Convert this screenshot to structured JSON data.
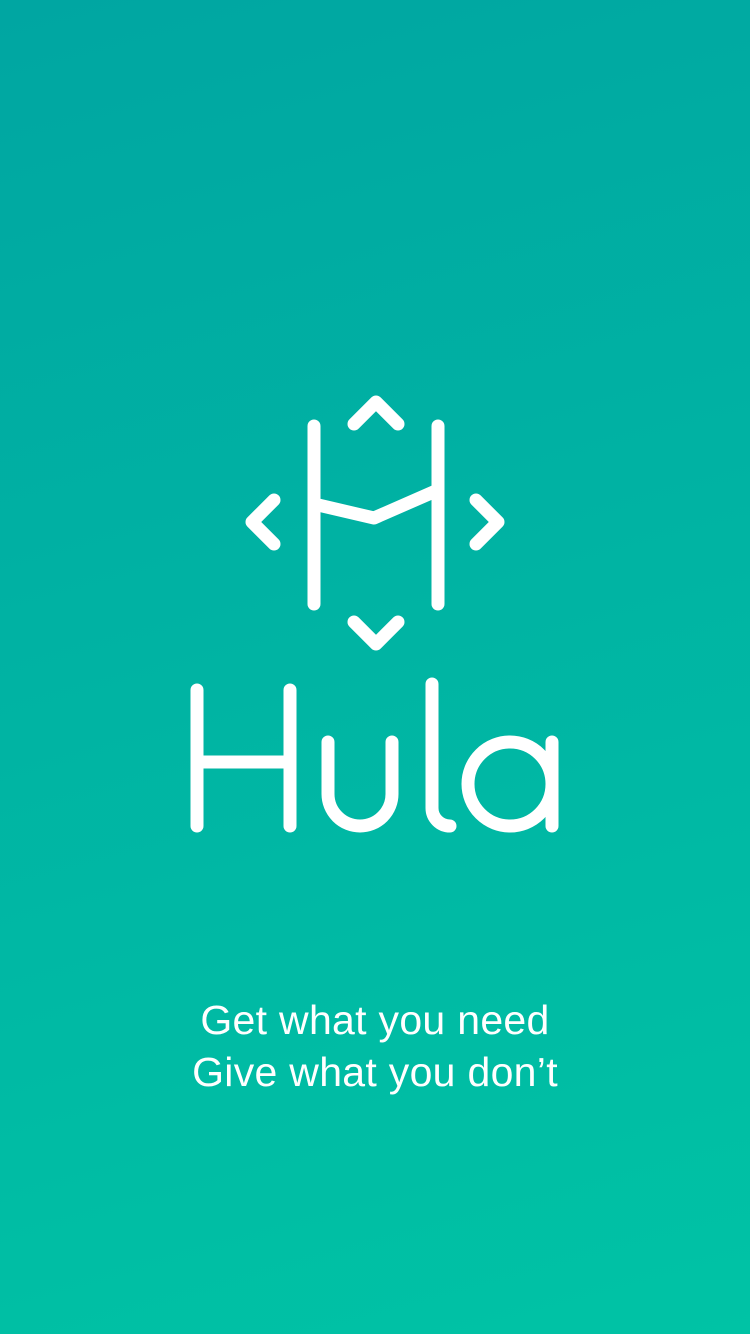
{
  "brand": {
    "name": "Hula",
    "logo_icon": "hula-h-arrows-logo-icon",
    "background_colors": [
      "#00a6a2",
      "#00c3a5"
    ],
    "foreground_color": "#ffffff"
  },
  "tagline": {
    "line1": "Get what you need",
    "line2": "Give what you don’t"
  }
}
